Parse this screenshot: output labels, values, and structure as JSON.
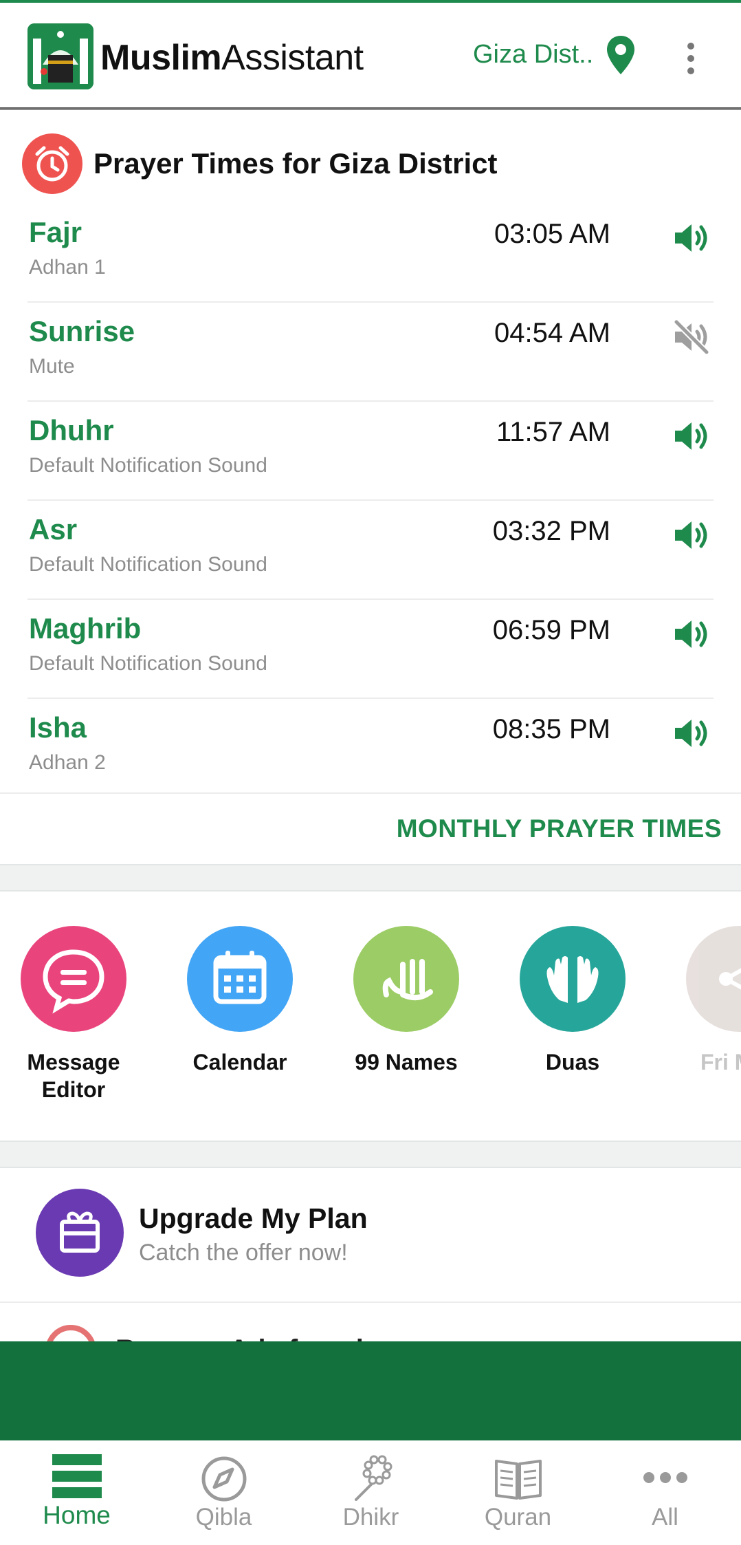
{
  "app": {
    "title_bold": "Muslim",
    "title_regular": "Assistant",
    "location": "Giza Dist..",
    "accent_color": "#1e8a4c"
  },
  "prayer_card": {
    "title": "Prayer Times for Giza District",
    "icon": "alarm-clock-icon",
    "prayers": [
      {
        "name": "Fajr",
        "sound": "Adhan 1",
        "time": "03:05 AM",
        "muted": false
      },
      {
        "name": "Sunrise",
        "sound": "Mute",
        "time": "04:54 AM",
        "muted": true
      },
      {
        "name": "Dhuhr",
        "sound": "Default Notification Sound",
        "time": "11:57 AM",
        "muted": false
      },
      {
        "name": "Asr",
        "sound": "Default Notification Sound",
        "time": "03:32 PM",
        "muted": false
      },
      {
        "name": "Maghrib",
        "sound": "Default Notification Sound",
        "time": "06:59 PM",
        "muted": false
      },
      {
        "name": "Isha",
        "sound": "Adhan 2",
        "time": "08:35 PM",
        "muted": false
      }
    ],
    "monthly_link": "MONTHLY PRAYER TIMES"
  },
  "shortcuts": [
    {
      "label": "Message Editor",
      "icon": "message-icon",
      "color": "#e9457c"
    },
    {
      "label": "Calendar",
      "icon": "calendar-icon",
      "color": "#42a5f5"
    },
    {
      "label": "99 Names",
      "icon": "allah-calligraphy-icon",
      "color": "#9ccc65"
    },
    {
      "label": "Duas",
      "icon": "praying-hands-icon",
      "color": "#26a69a"
    },
    {
      "label": "Fri Mes",
      "icon": "share-icon",
      "color": "#d7ccc8"
    }
  ],
  "upgrade": {
    "title": "Upgrade My Plan",
    "subtitle": "Catch the offer now!",
    "icon": "gift-icon"
  },
  "partial_item": {
    "text": "Remove Ads for a lo...",
    "icon": "no-ads-icon"
  },
  "bottom_nav": [
    {
      "label": "Home",
      "icon": "home-icon",
      "active": true
    },
    {
      "label": "Qibla",
      "icon": "compass-icon",
      "active": false
    },
    {
      "label": "Dhikr",
      "icon": "prayer-beads-icon",
      "active": false
    },
    {
      "label": "Quran",
      "icon": "book-icon",
      "active": false
    },
    {
      "label": "All",
      "icon": "more-dots-icon",
      "active": false
    }
  ]
}
